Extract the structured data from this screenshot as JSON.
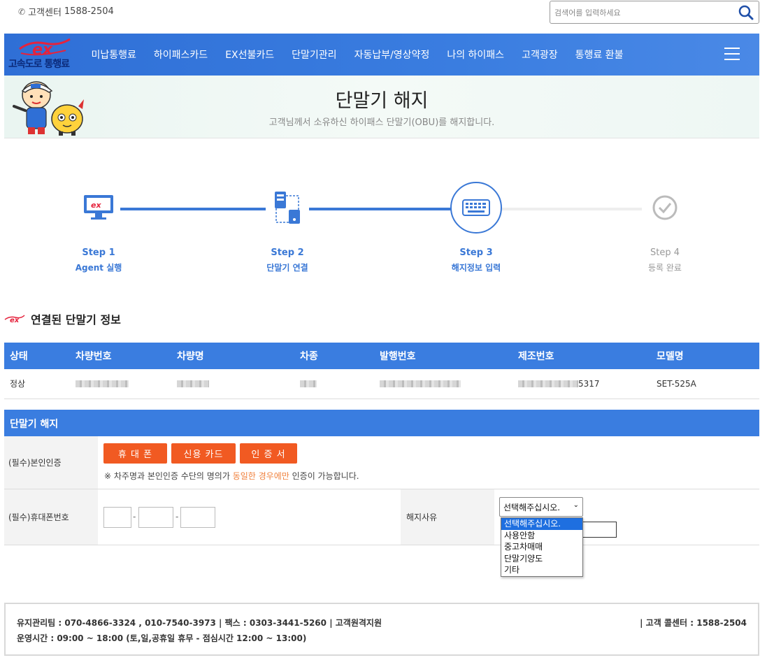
{
  "top": {
    "customer_center_label": "고객센터",
    "customer_center_phone": "1588-2504",
    "search_placeholder": "검색어를 입력하세요"
  },
  "nav": {
    "logo_text": "고속도로 통행료",
    "items": [
      "미납통행료",
      "하이패스카드",
      "EX선불카드",
      "단말기관리",
      "자동납부/영상약정",
      "나의 하이패스",
      "고객광장",
      "통행료 환불"
    ]
  },
  "banner": {
    "title": "단말기 해지",
    "subtitle": "고객님께서 소유하신 하이패스 단말기(OBU)를 해지합니다."
  },
  "steps": [
    {
      "num": "Step 1",
      "label": "Agent 실행",
      "icon": "monitor-ex-icon",
      "state": "done"
    },
    {
      "num": "Step 2",
      "label": "단말기 연결",
      "icon": "device-connect-icon",
      "state": "done"
    },
    {
      "num": "Step 3",
      "label": "해지정보 입력",
      "icon": "keyboard-icon",
      "state": "active"
    },
    {
      "num": "Step 4",
      "label": "등록 완료",
      "icon": "check-circle-icon",
      "state": "pending"
    }
  ],
  "device_info": {
    "title": "연결된 단말기 정보",
    "columns": [
      "상태",
      "차량번호",
      "차량명",
      "차종",
      "발행번호",
      "제조번호",
      "모델명"
    ],
    "row": {
      "status": "정상",
      "serial_suffix": "5317",
      "model": "SET-525A"
    }
  },
  "cancel_form": {
    "title": "단말기 해지",
    "auth_label": "(필수)본인인증",
    "auth_buttons": [
      "휴 대 폰",
      "신용 카드",
      "인 증 서"
    ],
    "notice_prefix": "※ 차주명과 본인인증 수단의 명의가 ",
    "notice_highlight": "동일한 경우에만",
    "notice_suffix": " 인증이 가능합니다.",
    "phone_label": "(필수)휴대폰번호",
    "phone_sep": "-",
    "reason_label": "해지사유",
    "reason_selected": "선택해주십시오.",
    "reason_options": [
      "선택해주십시오.",
      "사용안함",
      "중고차매매",
      "단말기양도",
      "기타"
    ]
  },
  "footer": {
    "line1": "유지관리팀 : 070-4866-3324 , 010-7540-3973  |  팩스 : 0303-3441-5260  |  고객원격지원",
    "line2": "운영시간 : 09:00 ~ 18:00 (토,일,공휴일 휴무 - 점심시간 12:00 ~ 13:00)",
    "right": "|   고객 콜센터 : 1588-2504"
  },
  "colors": {
    "primary_blue": "#3a7de0",
    "orange": "#f15a22",
    "highlight_orange": "#f0803c",
    "ex_red": "#e5233d"
  }
}
